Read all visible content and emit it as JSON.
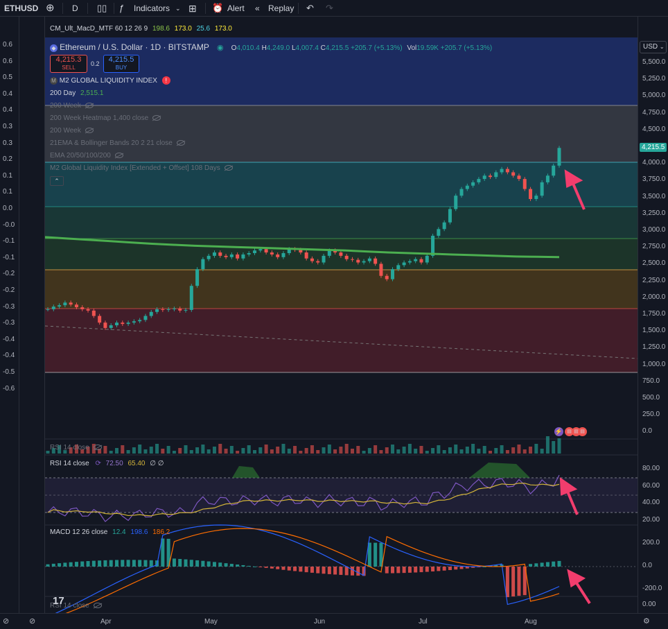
{
  "toolbar": {
    "symbol": "ETHUSD",
    "interval": "D",
    "indicators": "Indicators",
    "alert": "Alert",
    "replay": "Replay"
  },
  "top_legend": {
    "name": "CM_Ult_MacD_MTF 60 12 26 9",
    "v1": "198.6",
    "v2": "173.0",
    "v3": "25.6",
    "v4": "173.0"
  },
  "symbol_legend": {
    "title": "Ethereum / U.S. Dollar · 1D · BITSTAMP",
    "o_label": "O",
    "o": "4,010.4",
    "h_label": "H",
    "h": "4,249.0",
    "l_label": "L",
    "l": "4,007.4",
    "c_label": "C",
    "c": "4,215.5",
    "chg": "+205.7 (+5.13%)",
    "vol_label": "Vol",
    "vol": "19.59K",
    "vol_chg": "+205.7 (+5.13%)"
  },
  "trade": {
    "sell_price": "4,215.3",
    "sell_label": "SELL",
    "spread": "0.2",
    "buy_price": "4,215.5",
    "buy_label": "BUY"
  },
  "indicators": [
    {
      "label": "M2 GLOBAL LIQUIDITY INDEX",
      "hidden": false
    },
    {
      "label": "200 Day",
      "value": "2,515.1",
      "hidden": false
    },
    {
      "label": "200 Week",
      "hidden": true
    },
    {
      "label": "200 Week Heatmap 1,400 close",
      "hidden": true
    },
    {
      "label": "200 Week",
      "hidden": true
    },
    {
      "label": "21EMA & Bollinger Bands 20 2 21 close",
      "hidden": true
    },
    {
      "label": "EMA 20/50/100/200",
      "hidden": true
    },
    {
      "label": "M2 Global Liquidity Index [Extended + Offset] 108 Days",
      "hidden": true
    }
  ],
  "left_axis_ticks": [
    "0.6",
    "0.6",
    "0.5",
    "0.4",
    "0.4",
    "0.3",
    "0.3",
    "0.2",
    "0.1",
    "0.1",
    "0.0",
    "-0.0",
    "-0.1",
    "-0.1",
    "-0.2",
    "-0.2",
    "-0.3",
    "-0.3",
    "-0.4",
    "-0.4",
    "-0.5",
    "-0.6"
  ],
  "price_axis": {
    "currency": "USD",
    "ticks": [
      "5,500.0",
      "5,250.0",
      "5,000.0",
      "4,750.0",
      "4,500.0",
      "4,250.0",
      "4,000.0",
      "3,750.0",
      "3,500.0",
      "3,250.0",
      "3,000.0",
      "2,750.0",
      "2,500.0",
      "2,250.0",
      "2,000.0",
      "1,750.0",
      "1,500.0",
      "1,250.0",
      "1,000.0",
      "750.0",
      "500.0",
      "250.0",
      "0.0"
    ],
    "last_price": "4,215.5"
  },
  "volume_pane": {
    "label": "RSI 14 close"
  },
  "rsi_pane": {
    "label": "RSI 14 close",
    "v1": "72.50",
    "v2": "65.40",
    "extra": "∅ ∅",
    "ticks": [
      "80.00",
      "60.00",
      "40.00",
      "20.00"
    ]
  },
  "macd_pane": {
    "label": "MACD 12 26 close",
    "v1": "12.4",
    "v2": "198.6",
    "v3": "186.2",
    "ticks": [
      "200.0",
      "0.0",
      "-200.0"
    ]
  },
  "bottom_pane": {
    "label": "RSI 14 close",
    "tick": "0.00"
  },
  "x_axis": {
    "labels": [
      "Apr",
      "May",
      "Jun",
      "Jul",
      "Aug"
    ]
  },
  "colors": {
    "up": "#26a69a",
    "down": "#ef5350",
    "ma200": "#4caf50",
    "rsi": "#7e57c2",
    "rsi_ma": "#d4b53a",
    "macd": "#2962ff",
    "signal": "#ff6d00",
    "annotation": "#f23d6d"
  },
  "chart_data": {
    "type": "candlestick",
    "title": "Ethereum / U.S. Dollar · 1D · BITSTAMP",
    "x": [
      "Apr",
      "May",
      "Jun",
      "Jul",
      "Aug"
    ],
    "ylim": [
      0,
      5500
    ],
    "close_series": [
      1800,
      1840,
      1860,
      1900,
      1870,
      1830,
      1800,
      1780,
      1700,
      1600,
      1520,
      1560,
      1600,
      1580,
      1600,
      1620,
      1640,
      1700,
      1760,
      1800,
      1790,
      1800,
      1810,
      1780,
      1790,
      2150,
      2400,
      2550,
      2600,
      2650,
      2600,
      2580,
      2620,
      2560,
      2620,
      2640,
      2680,
      2700,
      2650,
      2620,
      2580,
      2640,
      2700,
      2690,
      2650,
      2560,
      2520,
      2500,
      2600,
      2680,
      2650,
      2600,
      2550,
      2540,
      2500,
      2520,
      2560,
      2480,
      2300,
      2250,
      2400,
      2460,
      2500,
      2520,
      2550,
      2500,
      2600,
      2900,
      3000,
      3100,
      3300,
      3500,
      3600,
      3650,
      3700,
      3750,
      3800,
      3780,
      3850,
      3900,
      3850,
      3800,
      3750,
      3600,
      3450,
      3500,
      3700,
      3800,
      3950,
      4215
    ],
    "ma200": [
      2900,
      2880,
      2860,
      2840,
      2820,
      2800,
      2780,
      2760,
      2740,
      2720,
      2700,
      2680,
      2660,
      2640,
      2620,
      2600,
      2590,
      2580,
      2570,
      2560,
      2550,
      2540,
      2530,
      2520,
      2515
    ],
    "rsi": {
      "last": 72.5,
      "ma": 65.4,
      "ticks": [
        80,
        60,
        40,
        20
      ]
    },
    "macd": {
      "hist": 12.4,
      "macd": 198.6,
      "signal": 186.2,
      "ticks": [
        200,
        0,
        -200
      ]
    }
  }
}
